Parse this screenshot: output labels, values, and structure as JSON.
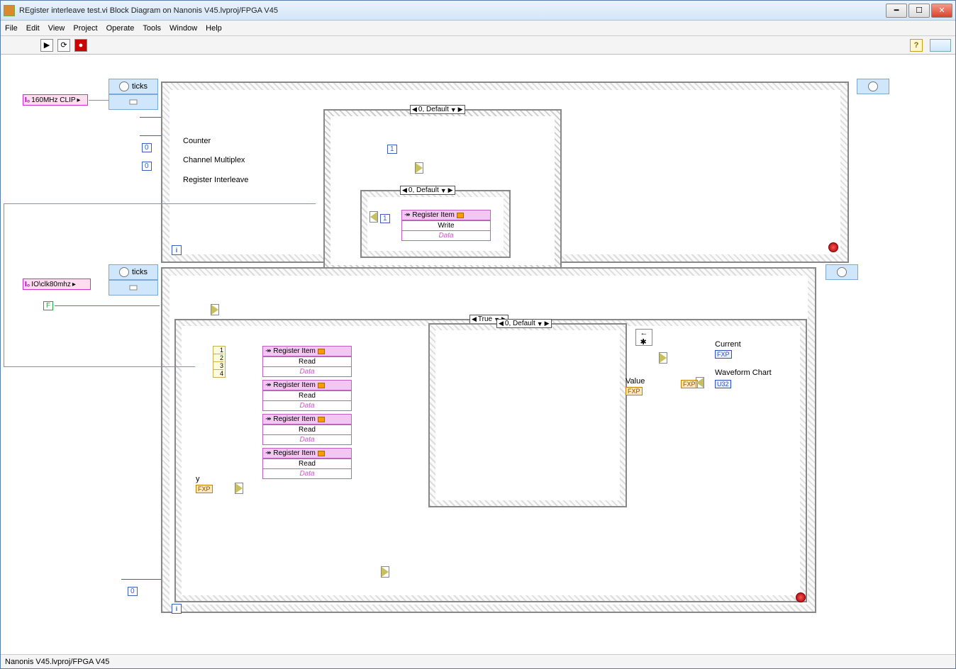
{
  "window": {
    "title": "REgister interleave test.vi Block Diagram on Nanonis V45.lvproj/FPGA V45"
  },
  "menu": {
    "file": "File",
    "edit": "Edit",
    "view": "View",
    "project": "Project",
    "operate": "Operate",
    "tools": "Tools",
    "window": "Window",
    "help": "Help"
  },
  "status": {
    "project_path": "Nanonis V45.lvproj/FPGA V45"
  },
  "loop1": {
    "ticks_label": "ticks",
    "clip": "160MHz CLIP",
    "labels": {
      "counter": "Counter",
      "chanmux": "Channel Multiplex",
      "regil": "Register Interleave"
    },
    "outer_case": "0, Default",
    "inner_case": "0, Default",
    "const_zero_a": "0",
    "const_zero_b": "0",
    "one_const_case": "1",
    "one_const_inner": "1",
    "reg": {
      "title": "Register Item",
      "op": "Write",
      "field": "Data"
    }
  },
  "loop2": {
    "ticks_label": "ticks",
    "clip": "IO\\clk80mhz",
    "bool_f": "F",
    "true_case": "True",
    "default_case": "0, Default",
    "bundle": [
      "1",
      "2",
      "3",
      "4"
    ],
    "reg1": {
      "title": "Register Item",
      "op": "Read",
      "field": "Data"
    },
    "reg2": {
      "title": "Register Item",
      "op": "Read",
      "field": "Data"
    },
    "reg3": {
      "title": "Register Item",
      "op": "Read",
      "field": "Data"
    },
    "reg4": {
      "title": "Register Item",
      "op": "Read",
      "field": "Data"
    },
    "y_label": "y",
    "fxp_small": "FXP",
    "zero_const": "0",
    "value_label": "Value",
    "value_ind": "FXP",
    "current_label": "Current",
    "current_ind": "FXP",
    "wave_label": "Waveform Chart",
    "wave_fxp": "FXP",
    "wave_u32": "U32"
  }
}
